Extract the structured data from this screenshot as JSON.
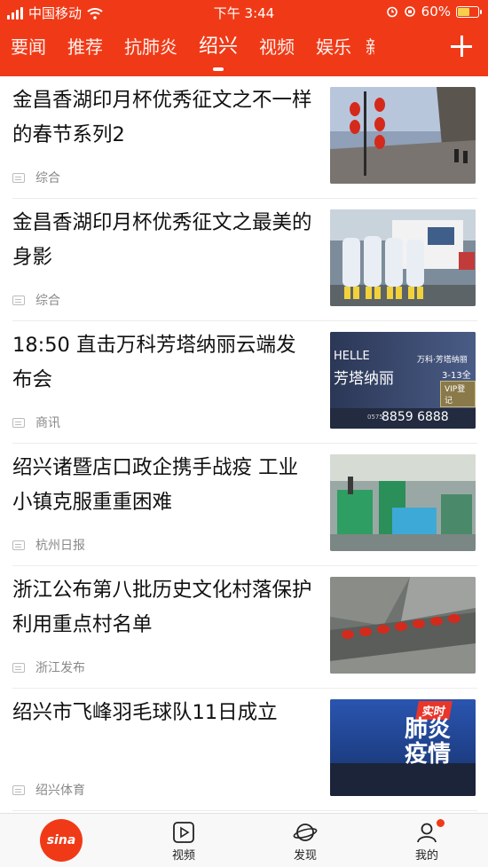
{
  "status": {
    "carrier": "中国移动",
    "time": "下午 3:44",
    "battery": "60%"
  },
  "tabs": [
    {
      "label": "要闻"
    },
    {
      "label": "推荐"
    },
    {
      "label": "抗肺炎"
    },
    {
      "label": "绍兴",
      "active": true
    },
    {
      "label": "视频"
    },
    {
      "label": "娱乐"
    }
  ],
  "tab_partial": "新",
  "news": [
    {
      "title": "金昌香湖印月杯优秀征文之不一样的春节系列2",
      "source": "综合"
    },
    {
      "title": "金昌香湖印月杯优秀征文之最美的身影",
      "source": "综合"
    },
    {
      "title": "18:50 直击万科芳塔纳丽云端发布会",
      "source": "商讯"
    },
    {
      "title": "绍兴诸暨店口政企携手战疫 工业小镇克服重重困难",
      "source": "杭州日报"
    },
    {
      "title": "浙江公布第八批历史文化村落保护利用重点村名单",
      "source": "浙江发布"
    },
    {
      "title": "绍兴市飞峰羽毛球队11日成立",
      "source": "绍兴体育"
    }
  ],
  "ad": {
    "brand_left": "HELLE",
    "brand_right": "万科·芳塔纳丽",
    "big_text": "芳塔纳丽",
    "date": "3-13全",
    "vip": "VIP登记",
    "phone_prefix": "0575",
    "phone": "8859 6888"
  },
  "badge": {
    "top": "实时",
    "line1": "肺炎",
    "line2": "疫情"
  },
  "bottom_nav": {
    "home": "sina",
    "video": "视频",
    "discover": "发现",
    "mine": "我的"
  },
  "colors": {
    "brand": "#f03a17"
  }
}
